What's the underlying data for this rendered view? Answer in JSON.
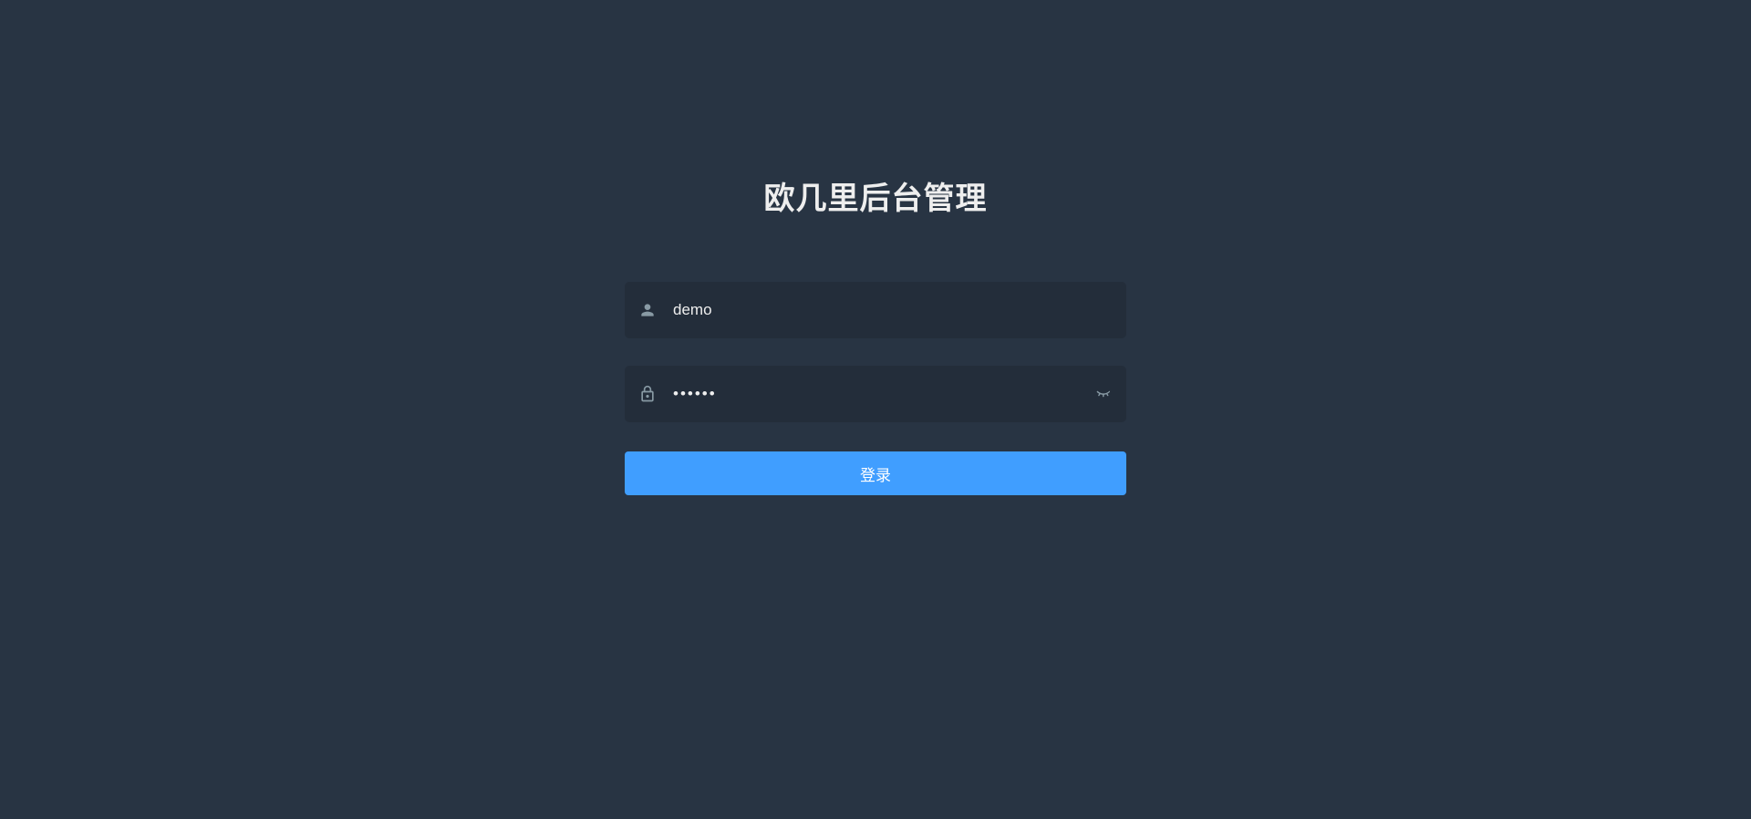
{
  "login": {
    "title": "欧几里后台管理",
    "username": {
      "value": "demo",
      "placeholder": ""
    },
    "password": {
      "value": "••••••",
      "placeholder": ""
    },
    "submit_label": "登录"
  }
}
